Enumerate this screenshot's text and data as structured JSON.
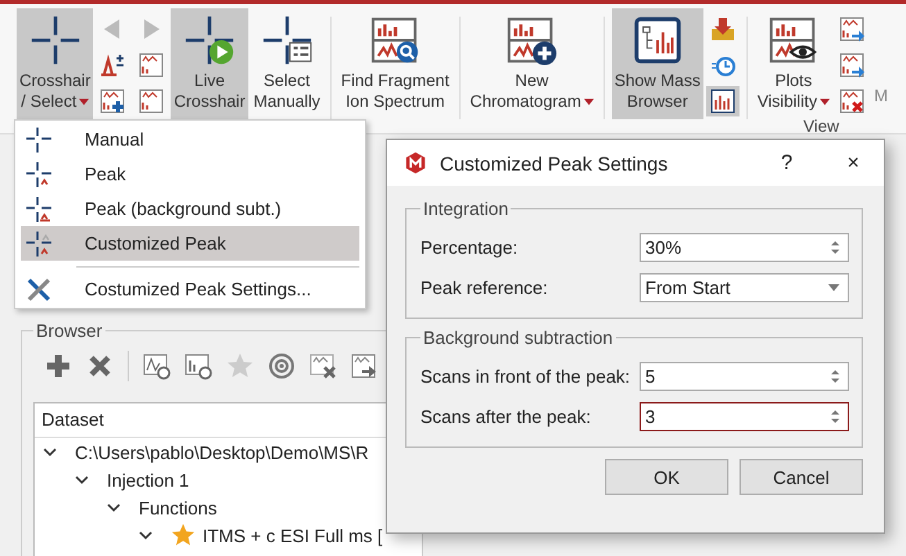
{
  "ribbon": {
    "groups": [
      {
        "items": [
          {
            "kind": "large",
            "lines": [
              "Crosshair",
              "/ Select"
            ],
            "selected": true,
            "dropdown": true
          },
          {
            "kind": "stack",
            "buttons": [
              {
                "selected": false
              },
              {
                "selected": false
              },
              {
                "selected": false
              },
              {
                "selected": false
              },
              {
                "selected": false
              },
              {
                "selected": false
              }
            ]
          },
          {
            "kind": "large",
            "lines": [
              "Live",
              "Crosshair"
            ],
            "selected": true,
            "dropdown": false
          },
          {
            "kind": "large",
            "lines": [
              "Select",
              "Manually"
            ],
            "selected": false,
            "dropdown": false
          }
        ]
      },
      {
        "items": [
          {
            "kind": "large",
            "lines": [
              "Find Fragment",
              "Ion Spectrum"
            ],
            "selected": false,
            "dropdown": false
          }
        ]
      },
      {
        "items": [
          {
            "kind": "large",
            "lines": [
              "New",
              "Chromatogram"
            ],
            "selected": false,
            "dropdown": true
          }
        ]
      },
      {
        "items": [
          {
            "kind": "large",
            "lines": [
              "Show Mass",
              "Browser"
            ],
            "selected": true,
            "dropdown": false
          },
          {
            "kind": "stack",
            "buttons": [
              {
                "selected": false
              },
              {
                "selected": false
              },
              {
                "selected": true
              }
            ]
          }
        ]
      },
      {
        "label": "View",
        "items": [
          {
            "kind": "large",
            "lines": [
              "Plots",
              "Visibility"
            ],
            "selected": false,
            "dropdown": true
          },
          {
            "kind": "stack",
            "buttons": [
              {
                "selected": false
              },
              {
                "selected": false
              },
              {
                "selected": false
              }
            ]
          },
          {
            "kind": "cut",
            "text": "M"
          }
        ]
      }
    ]
  },
  "browser": {
    "title": "Browser",
    "column": "Dataset",
    "tree": [
      {
        "label": "C:\\Users\\pablo\\Desktop\\Demo\\MS\\R",
        "expanded": true,
        "starred": false,
        "children": [
          {
            "label": "Injection 1",
            "expanded": true,
            "starred": false,
            "children": [
              {
                "label": "Functions",
                "expanded": true,
                "starred": false,
                "children": [
                  {
                    "label": "ITMS + c ESI Full ms [",
                    "expanded": true,
                    "starred": true
                  }
                ]
              }
            ]
          }
        ]
      }
    ]
  },
  "menu": {
    "items": [
      {
        "kind": "item",
        "label": "Manual",
        "selected": false
      },
      {
        "kind": "item",
        "label": "Peak",
        "selected": false
      },
      {
        "kind": "item",
        "label": "Peak (background subt.)",
        "selected": false
      },
      {
        "kind": "item",
        "label": "Customized Peak",
        "selected": true
      },
      {
        "kind": "separator"
      },
      {
        "kind": "item",
        "label": "Costumized Peak Settings...",
        "selected": false
      }
    ]
  },
  "dialog": {
    "title": "Customized Peak Settings",
    "help": "?",
    "close": "×",
    "groups": [
      {
        "title": "Integration",
        "fields": [
          {
            "label": "Percentage:",
            "kind": "spin",
            "value": "30%",
            "focused": false
          },
          {
            "label": "Peak reference:",
            "kind": "select",
            "value": "From Start",
            "focused": false
          }
        ]
      },
      {
        "title": "Background subtraction",
        "fields": [
          {
            "label": "Scans in front of the peak:",
            "kind": "spin",
            "value": "5",
            "focused": false
          },
          {
            "label": "Scans after the peak:",
            "kind": "spin",
            "value": "3",
            "focused": true
          }
        ]
      }
    ],
    "buttons": [
      "OK",
      "Cancel"
    ]
  }
}
